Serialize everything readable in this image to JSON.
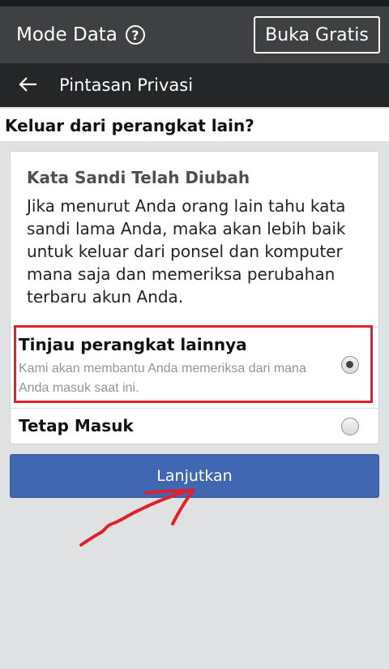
{
  "topbar": {
    "mode_label": "Mode Data",
    "help_glyph": "?",
    "free_button": "Buka Gratis"
  },
  "navbar": {
    "title": "Pintasan Privasi"
  },
  "question": "Keluar dari perangkat lain?",
  "card": {
    "title": "Kata Sandi Telah Diubah",
    "body": "Jika menurut Anda orang lain tahu kata sandi lama Anda, maka akan lebih baik untuk keluar dari ponsel dan komputer mana saja dan memeriksa perubahan terbaru akun Anda."
  },
  "options": [
    {
      "label": "Tinjau perangkat lainnya",
      "description": "Kami akan membantu Anda memeriksa dari mana Anda masuk saat ini.",
      "selected": true
    },
    {
      "label": "Tetap Masuk",
      "selected": false
    }
  ],
  "continue_button": "Lanjutkan",
  "colors": {
    "primary_button": "#4267b2",
    "topbar": "#3f4042",
    "navbar": "#252627",
    "annotation": "#e0202a"
  },
  "icons": {
    "help": "question-circle-icon",
    "back": "back-arrow-icon"
  }
}
